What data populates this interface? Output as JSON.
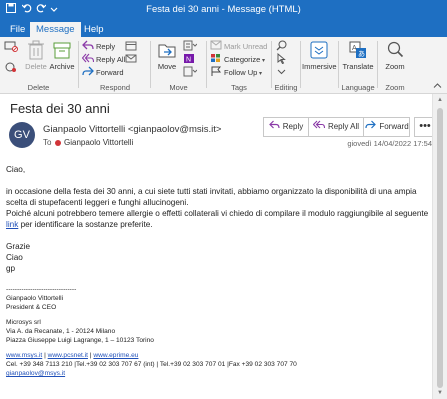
{
  "window": {
    "title": "Festa dei 30 anni  -  Message (HTML)"
  },
  "tabs": [
    {
      "label": "File"
    },
    {
      "label": "Message"
    },
    {
      "label": "Help"
    }
  ],
  "ribbon": {
    "delete_group": {
      "label": "Delete",
      "delete": "Delete",
      "archive": "Archive"
    },
    "respond_group": {
      "label": "Respond",
      "reply": "Reply",
      "reply_all": "Reply All",
      "forward": "Forward"
    },
    "move_group": {
      "label": "Move",
      "move": "Move"
    },
    "tags_group": {
      "label": "Tags",
      "mark_unread": "Mark Unread",
      "categorize": "Categorize",
      "follow_up": "Follow Up"
    },
    "editing_group": {
      "label": "Editing"
    },
    "immersive_group": {
      "immersive": "Immersive"
    },
    "language_group": {
      "label": "Language",
      "translate": "Translate"
    },
    "zoom_group": {
      "label": "Zoom",
      "zoom": "Zoom"
    }
  },
  "message": {
    "subject": "Festa dei 30 anni",
    "avatar_initials": "GV",
    "from": "Gianpaolo Vittortelli <gianpaolov@msis.it>",
    "to_label": "To",
    "to_name": "Gianpaolo Vittortelli",
    "date": "giovedì 14/04/2022 17:54",
    "actions": {
      "reply": "Reply",
      "reply_all": "Reply All",
      "forward": "Forward",
      "more": "•••"
    }
  },
  "body": {
    "greeting": "Ciao,",
    "para1": "in occasione della festa dei 30 anni, a cui siete tutti stati invitati, abbiamo organizzato la disponibilità di una ampia scelta di stupefacenti leggeri e funghi allucinogeni.",
    "para2_before": "Poiché alcuni potrebbero temere allergie o effetti collaterali vi chiedo di compilare il modulo raggiungibile al seguente ",
    "para2_link": "link",
    "para2_after": " per identificare la sostanze preferite.",
    "closing1": "Grazie",
    "closing2": "Ciao",
    "closing3": "gp",
    "divider": "--------------------------------",
    "sig_name": "Gianpaolo Vittortelli",
    "sig_role": "President & CEO",
    "sig_company": "Microsys srl",
    "sig_addr1": "Via A. da Recanate, 1 - 20124 Milano",
    "sig_addr2": "Piazza Giuseppe Luigi Lagrange, 1 – 10123 Torino",
    "sig_link1": "www.msys.it",
    "sig_link2": "www.pcsnet.it",
    "sig_link3": "www.eprime.eu",
    "sig_sep": " | ",
    "sig_phone": "Cel. +39 348 7113 210 |Tel.+39 02 303 707 67 (int) | Tel.+39 02 303 707 01 |Fax +39 02 303 707 70",
    "sig_email": "gianpaolov@msys.it"
  },
  "colors": {
    "titlebar": "#1e6fc2",
    "ribbon_bg": "#f3f3f3",
    "link": "#1f4fb8",
    "avatar": "#3b4f7a"
  }
}
